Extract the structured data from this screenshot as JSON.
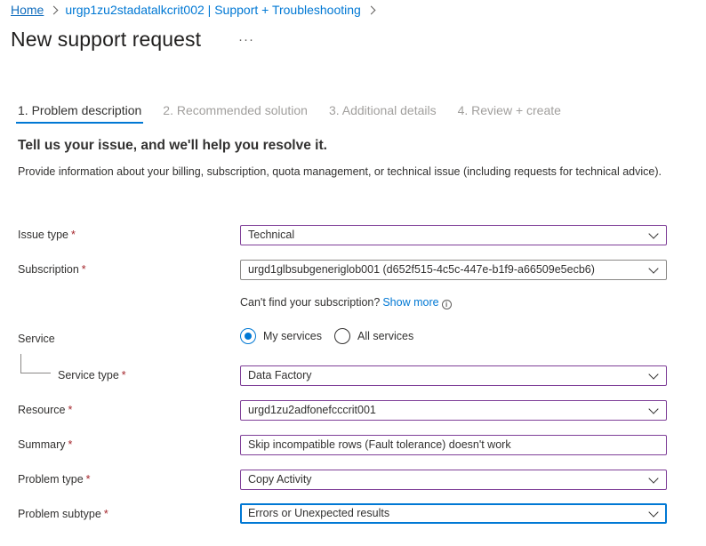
{
  "breadcrumb": {
    "home": "Home",
    "resource": "urgp1zu2stadatalkcrit002 | Support + Troubleshooting"
  },
  "page": {
    "title": "New support request",
    "more": "···"
  },
  "tabs": [
    {
      "label": "1. Problem description",
      "active": true
    },
    {
      "label": "2. Recommended solution",
      "active": false
    },
    {
      "label": "3. Additional details",
      "active": false
    },
    {
      "label": "4. Review + create",
      "active": false
    }
  ],
  "intro": {
    "heading": "Tell us your issue, and we'll help you resolve it.",
    "description": "Provide information about your billing, subscription, quota management, or technical issue (including requests for technical advice)."
  },
  "form": {
    "required_mark": "*",
    "issue_type": {
      "label": "Issue type",
      "value": "Technical"
    },
    "subscription": {
      "label": "Subscription",
      "value": "urgd1glbsubgenериglob001 (d652f515-4c5c-447e-b1f9-a66509e5ecb6)"
    },
    "subscription_hint": {
      "text": "Can't find your subscription?",
      "link": "Show more"
    },
    "service": {
      "label": "Service",
      "options": [
        {
          "label": "My services",
          "checked": true
        },
        {
          "label": "All services",
          "checked": false
        }
      ]
    },
    "service_type": {
      "label": "Service type",
      "value": "Data Factory"
    },
    "resource": {
      "label": "Resource",
      "value": "urgd1zu2adfonefcccrit001"
    },
    "summary": {
      "label": "Summary",
      "value": "Skip incompatible rows (Fault tolerance) doesn't work"
    },
    "problem_type": {
      "label": "Problem type",
      "value": "Copy Activity"
    },
    "problem_subtype": {
      "label": "Problem subtype",
      "value": "Errors or Unexpected results"
    }
  },
  "icons": {
    "breadcrumb_separator": "chevron-right-icon",
    "more": "ellipsis-icon",
    "info": "info-icon",
    "dropdown": "chevron-down-icon"
  },
  "colors": {
    "accent": "#0078d4",
    "required": "#a4262c",
    "field_border": "#7f3f98"
  }
}
